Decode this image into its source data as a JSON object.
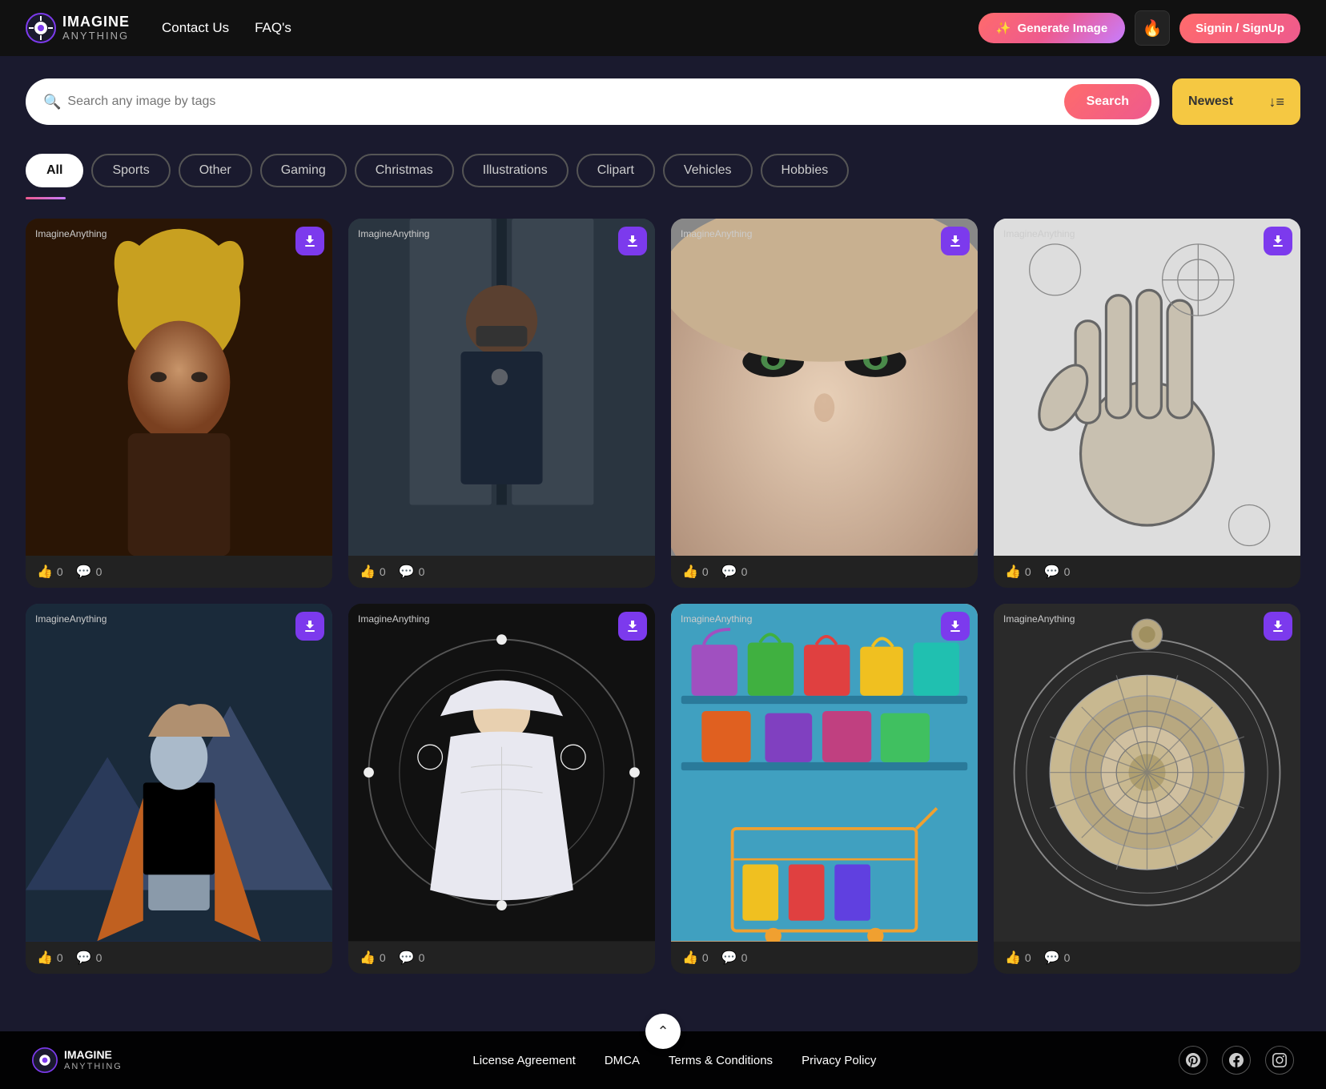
{
  "navbar": {
    "logo_imagine": "IMAGINE",
    "logo_anything": "ANYTHING",
    "nav_links": [
      {
        "id": "contact",
        "label": "Contact Us"
      },
      {
        "id": "faq",
        "label": "FAQ's"
      }
    ],
    "generate_btn": "Generate Image",
    "signin_btn": "Signin / SignUp",
    "fire_icon": "🔥"
  },
  "search": {
    "placeholder": "Search any image by tags",
    "btn_label": "Search",
    "sort_label": "Newest",
    "sort_icon": "↓≡"
  },
  "categories": [
    {
      "id": "all",
      "label": "All",
      "active": true
    },
    {
      "id": "sports",
      "label": "Sports",
      "active": false
    },
    {
      "id": "other",
      "label": "Other",
      "active": false
    },
    {
      "id": "gaming",
      "label": "Gaming",
      "active": false
    },
    {
      "id": "christmas",
      "label": "Christmas",
      "active": false
    },
    {
      "id": "illustrations",
      "label": "Illustrations",
      "active": false
    },
    {
      "id": "clipart",
      "label": "Clipart",
      "active": false
    },
    {
      "id": "vehicles",
      "label": "Vehicles",
      "active": false
    },
    {
      "id": "hobbies",
      "label": "Hobbies",
      "active": false
    }
  ],
  "image_cards": [
    {
      "id": "card1",
      "label": "ImagineAnything",
      "theme": "warrior-queen",
      "likes": "0",
      "comments": "0",
      "emoji": "👑"
    },
    {
      "id": "card2",
      "label": "ImagineAnything",
      "theme": "police-officer",
      "likes": "0",
      "comments": "0",
      "emoji": "👮"
    },
    {
      "id": "card3",
      "label": "ImagineAnything",
      "theme": "woman-portrait",
      "likes": "0",
      "comments": "0",
      "emoji": "👤"
    },
    {
      "id": "card4",
      "label": "ImagineAnything",
      "theme": "hand-sketch",
      "likes": "0",
      "comments": "0",
      "emoji": "✋"
    },
    {
      "id": "card5",
      "label": "ImagineAnything",
      "theme": "knight",
      "likes": "0",
      "comments": "0",
      "emoji": "⚔️"
    },
    {
      "id": "card6",
      "label": "ImagineAnything",
      "theme": "tarot-goddess",
      "likes": "0",
      "comments": "0",
      "emoji": "🌙"
    },
    {
      "id": "card7",
      "label": "ImagineAnything",
      "theme": "shopping-bags",
      "likes": "0",
      "comments": "0",
      "emoji": "🛍️"
    },
    {
      "id": "card8",
      "label": "ImagineAnything",
      "theme": "mandala",
      "likes": "0",
      "comments": "0",
      "emoji": "🔮"
    }
  ],
  "footer": {
    "logo_imagine": "IMAGINE",
    "logo_anything": "ANYTHING",
    "links": [
      {
        "id": "license",
        "label": "License Agreement"
      },
      {
        "id": "dmca",
        "label": "DMCA"
      },
      {
        "id": "terms",
        "label": "Terms & Conditions"
      },
      {
        "id": "privacy",
        "label": "Privacy Policy"
      }
    ],
    "social": [
      {
        "id": "pinterest",
        "icon": "𝗣"
      },
      {
        "id": "facebook",
        "icon": "f"
      },
      {
        "id": "instagram",
        "icon": "📷"
      }
    ],
    "scroll_top_icon": "⌃"
  }
}
